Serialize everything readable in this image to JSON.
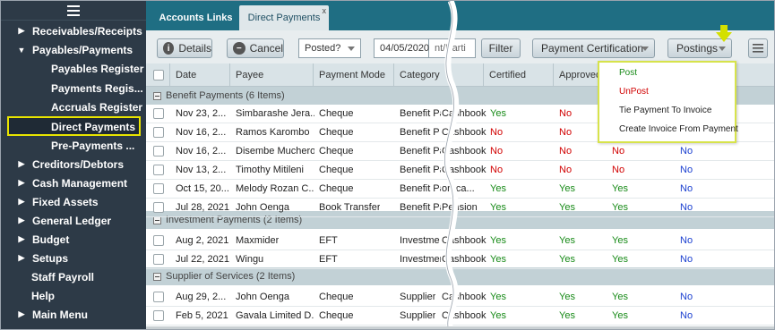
{
  "sidebar": {
    "items": [
      {
        "label": "Receivables/Receipts",
        "caret": "▶"
      },
      {
        "label": "Payables/Payments",
        "caret": "▼"
      },
      {
        "label": "Payables Register"
      },
      {
        "label": "Payments Regis..."
      },
      {
        "label": "Accruals Register"
      },
      {
        "label": "Direct Payments"
      },
      {
        "label": "Pre-Payments ..."
      },
      {
        "label": "Creditors/Debtors",
        "caret": "▶"
      },
      {
        "label": "Cash Management",
        "caret": "▶"
      },
      {
        "label": "Fixed Assets",
        "caret": "▶"
      },
      {
        "label": "General Ledger",
        "caret": "▶"
      },
      {
        "label": "Budget",
        "caret": "▶"
      },
      {
        "label": "Setups",
        "caret": "▶"
      },
      {
        "label": "Staff Payroll"
      },
      {
        "label": "Help"
      },
      {
        "label": "Main Menu",
        "caret": "▶"
      }
    ]
  },
  "tabs": [
    {
      "label": "Accounts Links"
    },
    {
      "label": "Direct Payments",
      "close": "x"
    }
  ],
  "toolbar": {
    "details": "Details",
    "cancel": "Cancel",
    "posted_select": "Posted?",
    "date_value": "04/05/2020",
    "search_value": "nt/Parti",
    "filter": "Filter",
    "payment_cert": "Payment Certification",
    "postings": "Postings"
  },
  "columns": [
    "Date",
    "Payee",
    "Payment Mode",
    "Category",
    "Certified",
    "Approved"
  ],
  "groups": [
    {
      "label": "Benefit Payments (6 Items)"
    },
    {
      "label": "Investment Payments (2 Items)"
    },
    {
      "label": "Supplier of Services (2 Items)"
    }
  ],
  "rows": [
    {
      "date": "Nov 23, 2...",
      "payee": "Simbarashe Jera...",
      "mode": "Cheque",
      "cat": "Benefit Pa",
      "acct": "Cashbook",
      "cert": "Yes",
      "appr": "No",
      "c3": "",
      "c4": ""
    },
    {
      "date": "Nov 16, 2...",
      "payee": "Ramos Karombo",
      "mode": "Cheque",
      "cat": "Benefit P",
      "acct": "Cashbook",
      "cert": "No",
      "appr": "No",
      "c3": "",
      "c4": ""
    },
    {
      "date": "Nov 16, 2...",
      "payee": "Disembe Muchero",
      "mode": "Cheque",
      "cat": "Benefit Pa",
      "acct": "Cashbook",
      "cert": "No",
      "appr": "No",
      "c3": "No",
      "c4": "No"
    },
    {
      "date": "Nov 13, 2...",
      "payee": "Timothy Mitileni",
      "mode": "Cheque",
      "cat": "Benefit Pa",
      "acct": "Cashbook",
      "cert": "No",
      "appr": "No",
      "c3": "No",
      "c4": "No"
    },
    {
      "date": "Oct 15, 20...",
      "payee": "Melody Rozan C...",
      "mode": "Cheque",
      "cat": "Benefit Pa",
      "acct": "ort ca...",
      "cert": "Yes",
      "appr": "Yes",
      "c3": "Yes",
      "c4": "No"
    },
    {
      "date": "Jul 28, 2021",
      "payee": "John Oenga",
      "mode": "Book Transfer",
      "cat": "Benefit Pa",
      "acct": "Pension",
      "cert": "Yes",
      "appr": "Yes",
      "c3": "Yes",
      "c4": "No"
    },
    {
      "date": "Aug 2, 2021",
      "payee": "Maxmider",
      "mode": "EFT",
      "cat": "Investme",
      "acct": "Cashbook",
      "cert": "Yes",
      "appr": "Yes",
      "c3": "Yes",
      "c4": "No"
    },
    {
      "date": "Jul 22, 2021",
      "payee": "Wingu",
      "mode": "EFT",
      "cat": "Investmen",
      "acct": "Cashbook",
      "cert": "Yes",
      "appr": "Yes",
      "c3": "Yes",
      "c4": "No"
    },
    {
      "date": "Aug 29, 2...",
      "payee": "John Oenga",
      "mode": "Cheque",
      "cat": "Supplier",
      "acct": "Cashbook",
      "cert": "Yes",
      "appr": "Yes",
      "c3": "Yes",
      "c4": "No"
    },
    {
      "date": "Feb 5, 2021",
      "payee": "Gavala Limited D...",
      "mode": "Cheque",
      "cat": "Supplier",
      "acct": "Cashbook",
      "cert": "Yes",
      "appr": "Yes",
      "c3": "Yes",
      "c4": "No"
    }
  ],
  "postings_menu": [
    {
      "label": "Post",
      "color": "#178a17"
    },
    {
      "label": "UnPost",
      "color": "#d10000"
    },
    {
      "label": "Tie Payment To Invoice",
      "color": "#222222"
    },
    {
      "label": "Create Invoice From Payment",
      "color": "#222222"
    }
  ]
}
